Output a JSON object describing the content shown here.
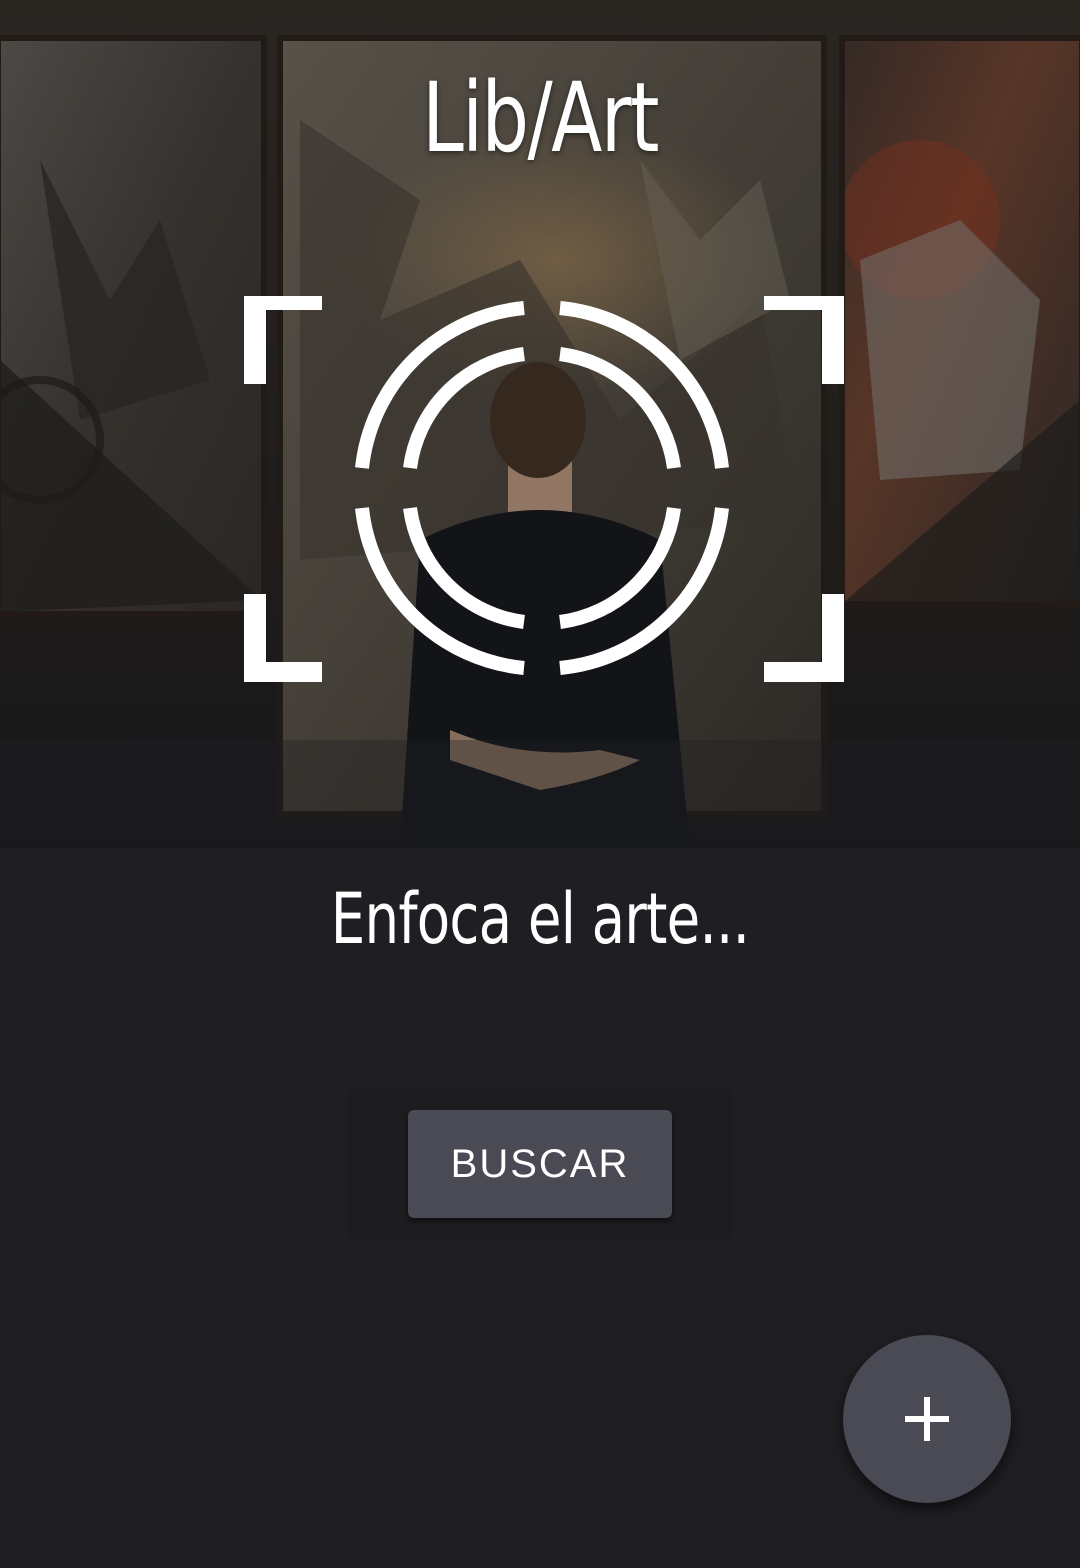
{
  "app": {
    "title": "Lib/Art"
  },
  "hero": {
    "subtitle": "Enfoca el arte..."
  },
  "actions": {
    "search_label": "BUSCAR",
    "fab_icon": "plus-icon"
  },
  "colors": {
    "background": "#1f1f23",
    "button": "#4a4a54",
    "text": "#ffffff"
  }
}
